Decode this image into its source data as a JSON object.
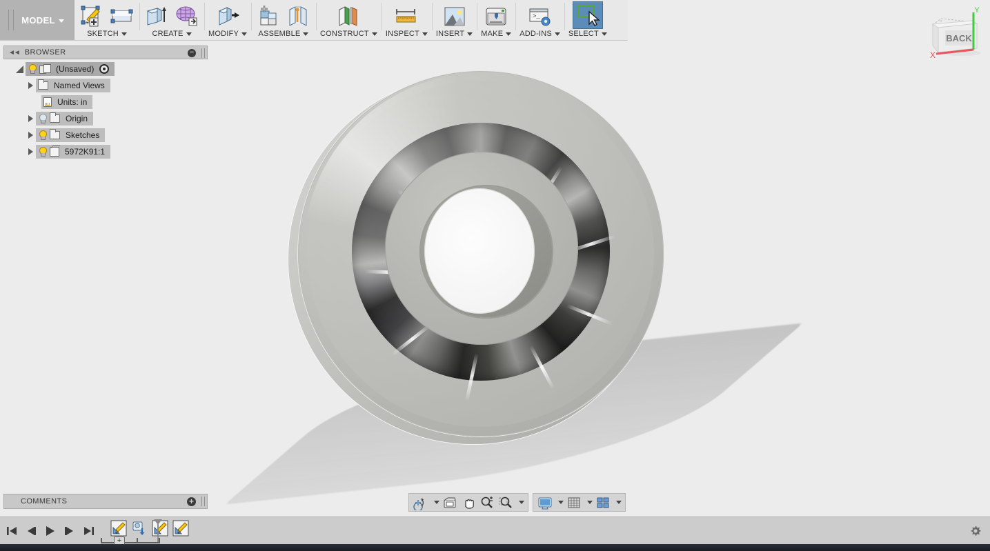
{
  "app": {
    "workspace_tab": "MODEL",
    "workspace_caret": "▾"
  },
  "ribbon": {
    "groups": [
      {
        "label": "SKETCH",
        "icons": [
          "create-sketch-icon",
          "sketch-plane-icon"
        ]
      },
      {
        "label": "CREATE",
        "icons": [
          "extrude-icon",
          "create-form-icon"
        ]
      },
      {
        "label": "MODIFY",
        "icons": [
          "press-pull-icon"
        ]
      },
      {
        "label": "ASSEMBLE",
        "icons": [
          "new-component-icon",
          "joint-icon"
        ]
      },
      {
        "label": "CONSTRUCT",
        "icons": [
          "offset-plane-icon"
        ]
      },
      {
        "label": "INSPECT",
        "icons": [
          "measure-icon"
        ]
      },
      {
        "label": "INSERT",
        "icons": [
          "insert-image-icon"
        ]
      },
      {
        "label": "MAKE",
        "icons": [
          "3d-print-icon"
        ]
      },
      {
        "label": "ADD-INS",
        "icons": [
          "scripts-addins-icon"
        ]
      },
      {
        "label": "SELECT",
        "icons": [
          "select-window-icon"
        ],
        "selected": true
      }
    ]
  },
  "browser": {
    "title": "BROWSER",
    "collapse_icon": "collapse-left-icon",
    "minimize_icon": "minimize-icon",
    "tree": [
      {
        "label": "(Unsaved)",
        "icon": "component-icon",
        "disclosure": "open",
        "bulb": "on",
        "indent": 0,
        "selected": true,
        "target": true
      },
      {
        "label": "Named Views",
        "icon": "folder-icon",
        "disclosure": "closed",
        "bulb": "none",
        "indent": 1,
        "selected": false,
        "target": false
      },
      {
        "label": "Units: in",
        "icon": "document-icon",
        "disclosure": "none",
        "bulb": "none",
        "indent": 1,
        "selected": false,
        "target": false
      },
      {
        "label": "Origin",
        "icon": "folder-icon",
        "disclosure": "closed",
        "bulb": "off",
        "indent": 1,
        "selected": false,
        "target": false
      },
      {
        "label": "Sketches",
        "icon": "folder-icon",
        "disclosure": "closed",
        "bulb": "on",
        "indent": 1,
        "selected": false,
        "target": false
      },
      {
        "label": "5972K91:1",
        "icon": "body-icon",
        "disclosure": "closed",
        "bulb": "on",
        "indent": 1,
        "selected": false,
        "target": false
      }
    ]
  },
  "comments": {
    "title": "COMMENTS",
    "add_icon": "add-comment-icon"
  },
  "navbar": {
    "groups": [
      {
        "buttons": [
          {
            "name": "orbit-icon",
            "dropdown": true
          },
          {
            "name": "look-at-icon",
            "dropdown": false
          },
          {
            "name": "pan-icon",
            "dropdown": false
          },
          {
            "name": "zoom-icon",
            "dropdown": false
          },
          {
            "name": "zoom-window-icon",
            "dropdown": true
          }
        ]
      },
      {
        "buttons": [
          {
            "name": "display-settings-icon",
            "dropdown": true
          },
          {
            "name": "grid-snap-icon",
            "dropdown": true
          },
          {
            "name": "viewports-icon",
            "dropdown": true
          }
        ]
      }
    ]
  },
  "timeline": {
    "playback": [
      "go-to-beginning-icon",
      "step-back-icon",
      "play-icon",
      "step-forward-icon",
      "go-to-end-icon"
    ],
    "features": [
      {
        "name": "sketch-feature-icon",
        "type": "sketch"
      },
      {
        "name": "insert-mcmaster-part-icon",
        "type": "insert"
      },
      {
        "name": "sketch-feature-icon",
        "type": "sketch"
      },
      {
        "name": "sketch-feature-icon",
        "type": "sketch"
      }
    ],
    "group_expand_label": "+",
    "marker_icon": "timeline-marker-icon",
    "settings_icon": "gear-icon"
  },
  "viewcube": {
    "face_label": "BACK",
    "axes": [
      {
        "label": "X",
        "color": "#e8555f"
      },
      {
        "label": "Y",
        "color": "#3fcc3f"
      }
    ]
  },
  "model": {
    "name": "5972K91 ball bearing",
    "description": "Shaded grayscale ball bearing viewed from the BACK orientation with ground shadow"
  },
  "colors": {
    "canvas_bg": "#ececec",
    "ribbon_bg": "#e8e8e8",
    "workspace_tab_bg": "#b3b3b3",
    "panel_header_bg": "#c8c8c8",
    "tree_pill_bg": "#bdbdbd",
    "tree_selected_bg": "#a9a9a9",
    "timeline_bg": "#cccccc",
    "select_highlight": "#5b8db8",
    "bulb_on": "#ffd21e",
    "axis_x": "#e8555f",
    "axis_y": "#3fcc3f"
  }
}
